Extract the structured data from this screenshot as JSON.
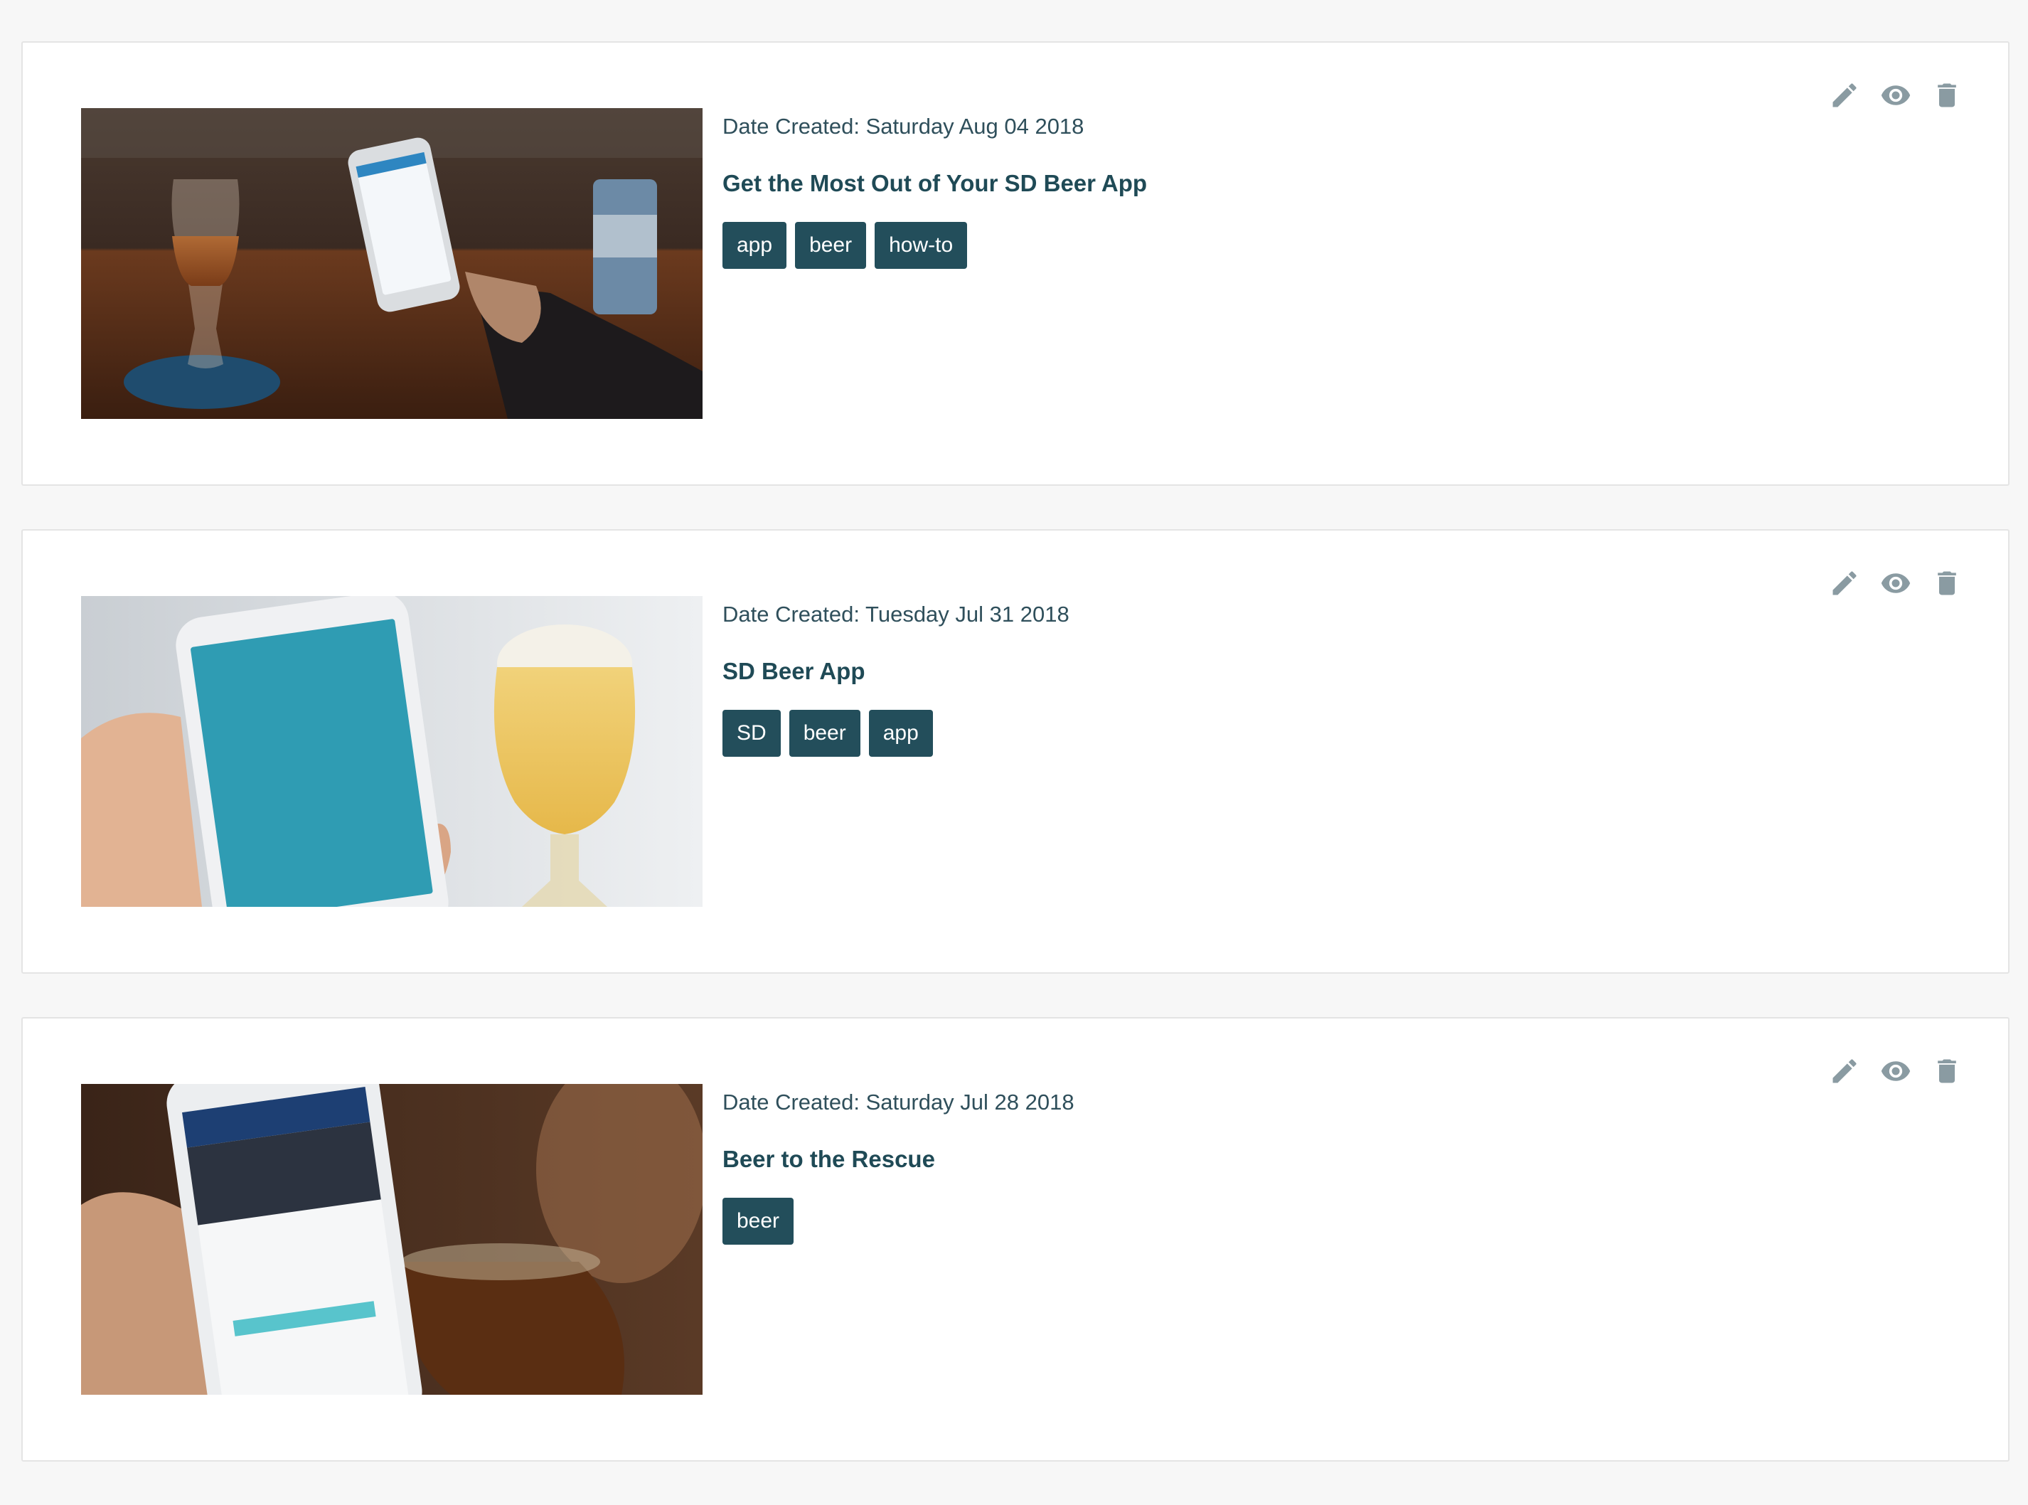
{
  "posts": [
    {
      "date": "Date Created: Saturday Aug 04 2018",
      "title": "Get the Most Out of Your SD Beer App",
      "tags": [
        "app",
        "beer",
        "how-to"
      ],
      "image_subject": "hand holding phone next to beer glass and can on bar"
    },
    {
      "date": "Date Created: Tuesday Jul 31 2018",
      "title": "SD Beer App",
      "tags": [
        "SD",
        "beer",
        "app"
      ],
      "image_subject": "hand holding phone showing SD Beer splash screen next to a pale beer"
    },
    {
      "date": "Date Created: Saturday Jul 28 2018",
      "title": "Beer to the Rescue",
      "tags": [
        "beer"
      ],
      "image_subject": "hand holding phone showing a news article next to a dark beer"
    }
  ],
  "actions": {
    "edit_icon": "pencil-icon",
    "view_icon": "eye-icon",
    "delete_icon": "trash-icon",
    "icon_color": "#8a9ba2"
  },
  "colors": {
    "tag_bg": "#234e5b",
    "title": "#1f4a56",
    "page_bg": "#f7f7f7"
  }
}
